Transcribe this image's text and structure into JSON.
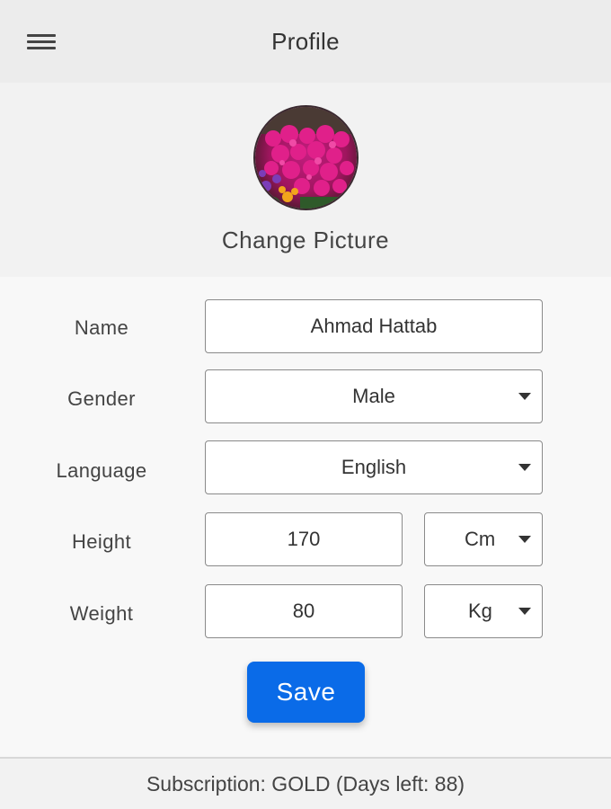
{
  "header": {
    "title": "Profile",
    "menu_icon": "hamburger-menu-icon"
  },
  "avatar": {
    "change_label": "Change Picture"
  },
  "form": {
    "name": {
      "label": "Name",
      "value": "Ahmad Hattab"
    },
    "gender": {
      "label": "Gender",
      "value": "Male"
    },
    "language": {
      "label": "Language",
      "value": "English"
    },
    "height": {
      "label": "Height",
      "value": "170",
      "unit": "Cm"
    },
    "weight": {
      "label": "Weight",
      "value": "80",
      "unit": "Kg"
    }
  },
  "actions": {
    "save_label": "Save"
  },
  "footer": {
    "subscription_text": "Subscription: GOLD (Days left: 88)"
  },
  "colors": {
    "primary": "#0a6be8",
    "header_bg": "#ececec",
    "page_bg": "#f8f8f8"
  }
}
